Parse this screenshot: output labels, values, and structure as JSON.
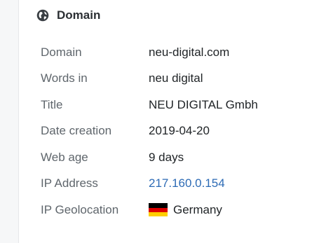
{
  "section": {
    "title": "Domain",
    "icon": "globe-icon"
  },
  "rows": [
    {
      "label": "Domain",
      "value": "neu-digital.com"
    },
    {
      "label": "Words in",
      "value": "neu digital"
    },
    {
      "label": "Title",
      "value": "NEU DIGITAL Gmbh"
    },
    {
      "label": "Date creation",
      "value": "2019-04-20"
    },
    {
      "label": "Web age",
      "value": "9 days"
    },
    {
      "label": "IP Address",
      "value": "217.160.0.154",
      "link_color": "#2d6bb5"
    },
    {
      "label": "IP Geolocation",
      "value": "Germany",
      "flag_icon": "germany-flag-icon",
      "flag_colors": [
        "#000000",
        "#dd0000",
        "#ffce00"
      ]
    }
  ]
}
